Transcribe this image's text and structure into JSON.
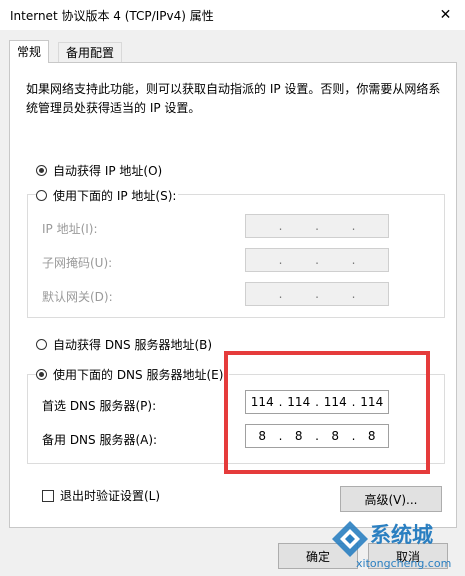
{
  "window": {
    "title": "Internet 协议版本 4 (TCP/IPv4) 属性",
    "close_glyph": "✕"
  },
  "tabs": [
    {
      "label": "常规",
      "selected": true
    },
    {
      "label": "备用配置",
      "selected": false
    }
  ],
  "description": "如果网络支持此功能，则可以获取自动指派的 IP 设置。否则，你需要从网络系统管理员处获得适当的 IP 设置。",
  "ip_section": {
    "auto_label": "自动获得 IP 地址(O)",
    "auto_selected": true,
    "manual_label": "使用下面的 IP 地址(S):",
    "manual_selected": false,
    "fields": [
      {
        "label": "IP 地址(I):",
        "octets": [
          "",
          "",
          "",
          ""
        ]
      },
      {
        "label": "子网掩码(U):",
        "octets": [
          "",
          "",
          "",
          ""
        ]
      },
      {
        "label": "默认网关(D):",
        "octets": [
          "",
          "",
          "",
          ""
        ]
      }
    ]
  },
  "dns_section": {
    "auto_label": "自动获得 DNS 服务器地址(B)",
    "auto_selected": false,
    "manual_label": "使用下面的 DNS 服务器地址(E):",
    "manual_selected": true,
    "fields": [
      {
        "label": "首选 DNS 服务器(P):",
        "octets": [
          "114",
          "114",
          "114",
          "114"
        ]
      },
      {
        "label": "备用 DNS 服务器(A):",
        "octets": [
          "8",
          "8",
          "8",
          "8"
        ]
      }
    ]
  },
  "validate_on_exit": {
    "label": "退出时验证设置(L)",
    "checked": false
  },
  "buttons": {
    "advanced": "高级(V)...",
    "ok": "确定",
    "cancel": "取消"
  },
  "highlight_color": "#e53b3b",
  "watermark": {
    "brand": "系统城",
    "url": "xitongcheng.com"
  }
}
